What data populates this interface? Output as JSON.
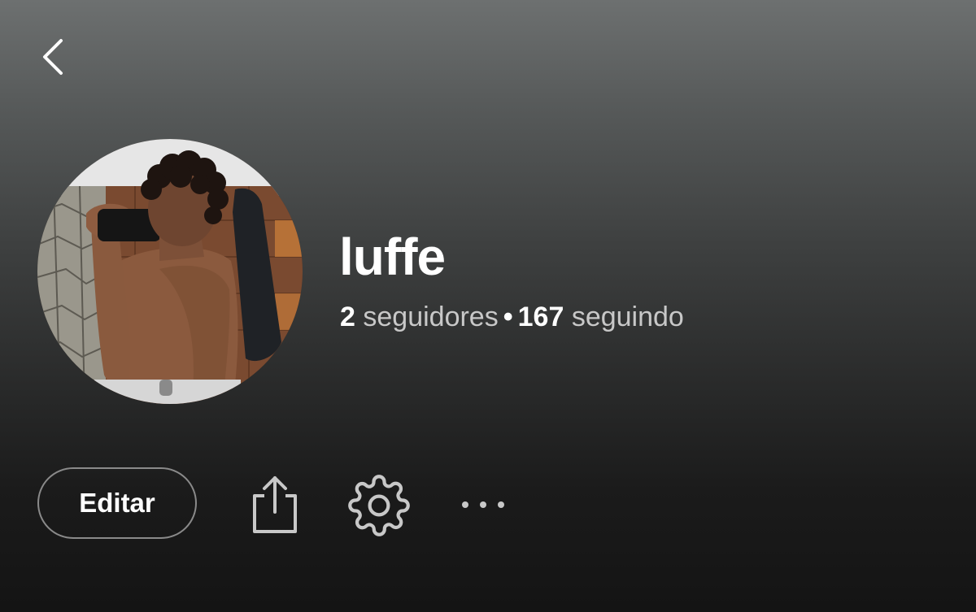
{
  "header": {
    "back_icon": "chevron-left-icon"
  },
  "profile": {
    "name": "luffe",
    "avatar": "profile-photo",
    "followers_count": "2",
    "followers_label": "seguidores",
    "separator": "•",
    "following_count": "167",
    "following_label": "seguindo"
  },
  "actions": {
    "edit_label": "Editar",
    "share_icon": "share-icon",
    "settings_icon": "gear-icon",
    "more_icon": "more-horizontal-icon"
  },
  "colors": {
    "background_top": "#6d7070",
    "background_bottom": "#141414",
    "text_primary": "#ffffff",
    "text_secondary": "#c8c8c8",
    "button_border": "#8a8a8a"
  }
}
